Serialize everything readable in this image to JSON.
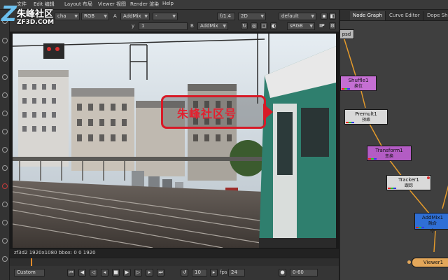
{
  "menu": {
    "items": [
      "文件",
      "Edit 编辑",
      "Layout 布局",
      "Viewer 视图",
      "Render 渲染",
      "Help"
    ]
  },
  "watermark": {
    "glyph": "Z",
    "brand_cn": "朱峰社区",
    "brand_url": "ZF3D.COM"
  },
  "viewer_toolbar": {
    "channel_a": "cha",
    "colorspace_a": "RGB",
    "label_a": "A",
    "merge_a": "AddMix",
    "dash_a": "-",
    "gain": "f/1.4",
    "view_mode": "2D",
    "lut": "default",
    "y_label": "y",
    "y_value": "1",
    "label_b": "B",
    "merge_b": "AddMix",
    "colorspace_b": "sRGB",
    "ip_label": "IP"
  },
  "viewer": {
    "overlay_text": "朱峰社区号",
    "info": "zf3d2 1920x1080 bbox: 0 0 1920"
  },
  "playback": {
    "preset": "Custom",
    "frame": "10",
    "fps_label": "fps",
    "fps": "24",
    "range": "0-60"
  },
  "node_graph": {
    "tabs": [
      "Node Graph",
      "Curve Editor",
      "Dope She"
    ],
    "read_label": "psd",
    "nodes": [
      {
        "id": "shuffle",
        "title": "Shuffle1",
        "sub": "换位",
        "color": "#c56fd3"
      },
      {
        "id": "premult",
        "title": "Premult1",
        "sub": "预乘",
        "color": "#d9d9d9"
      },
      {
        "id": "transform",
        "title": "Transform1",
        "sub": "变换",
        "color": "#b35cc4"
      },
      {
        "id": "tracker",
        "title": "Tracker1",
        "sub": "跟踪",
        "color": "#d9d9d9"
      },
      {
        "id": "addmix",
        "title": "AddMix1",
        "sub": "融合",
        "color": "#2f6fd6"
      },
      {
        "id": "viewer",
        "title": "Viewer1",
        "sub": "",
        "color": "#e3a75a"
      }
    ],
    "edge_color": "#e49a2b"
  }
}
